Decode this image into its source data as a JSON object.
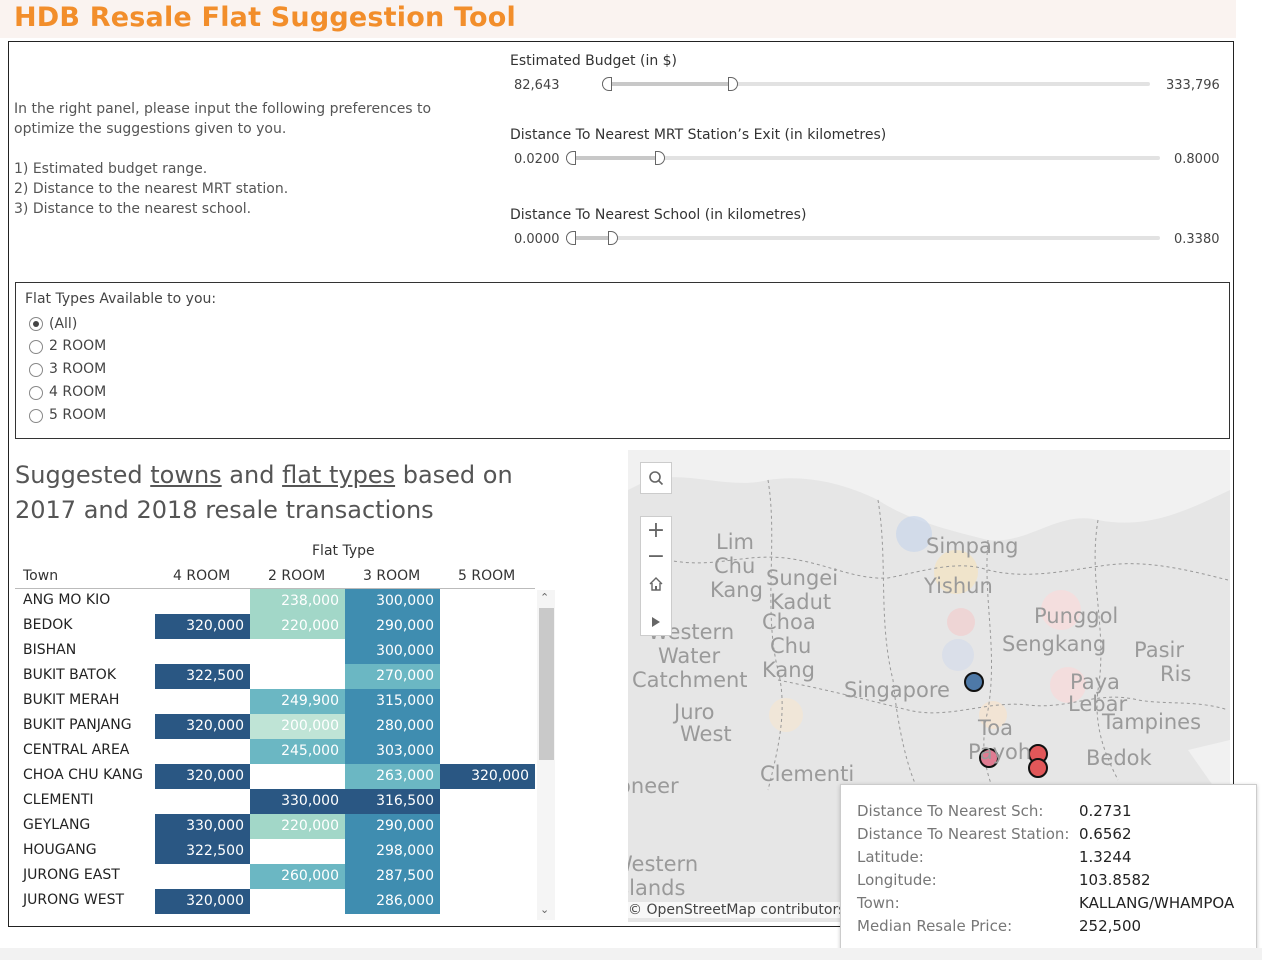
{
  "app": {
    "title": "HDB Resale Flat Suggestion Tool"
  },
  "instructions": {
    "intro": [
      "In the right panel, please input the following preferences to",
      "optimize the suggestions given to you."
    ],
    "items": [
      "1) Estimated budget range.",
      "2) Distance to the nearest MRT station.",
      "3) Distance to the nearest school."
    ]
  },
  "sliders": {
    "budget": {
      "label": "Estimated Budget (in $)",
      "min": "82,643",
      "max": "333,796",
      "fill_start": 0.0,
      "fill_end": 0.24
    },
    "mrt": {
      "label": "Distance To Nearest MRT Station’s Exit (in kilometres)",
      "min": "0.0200",
      "max": "0.8000",
      "fill_start": 0.0,
      "fill_end": 0.16
    },
    "school": {
      "label": "Distance To Nearest School (in kilometres)",
      "min": "0.0000",
      "max": "0.3380",
      "fill_start": 0.0,
      "fill_end": 0.08
    }
  },
  "flat_types": {
    "title": "Flat Types Available to you:",
    "options": [
      "(All)",
      "2 ROOM",
      "3 ROOM",
      "4 ROOM",
      "5 ROOM"
    ],
    "selected": "(All)"
  },
  "suggestions": {
    "heading_line1_a": "Suggested ",
    "heading_towns": "towns",
    "heading_and": " and ",
    "heading_flat_types": "flat types",
    "heading_line1_b": " based on",
    "heading_line2": "2017 and 2018 resale transactions"
  },
  "table": {
    "group_header": "Flat Type",
    "row_header": "Town",
    "columns": [
      "4 ROOM",
      "2 ROOM",
      "3 ROOM",
      "5 ROOM"
    ],
    "rows": [
      {
        "town": "ANG MO KIO",
        "values": [
          "",
          "238,000",
          "300,000",
          ""
        ]
      },
      {
        "town": "BEDOK",
        "values": [
          "320,000",
          "220,000",
          "290,000",
          ""
        ]
      },
      {
        "town": "BISHAN",
        "values": [
          "",
          "",
          "300,000",
          ""
        ]
      },
      {
        "town": "BUKIT BATOK",
        "values": [
          "322,500",
          "",
          "270,000",
          ""
        ]
      },
      {
        "town": "BUKIT MERAH",
        "values": [
          "",
          "249,900",
          "315,000",
          ""
        ]
      },
      {
        "town": "BUKIT PANJANG",
        "values": [
          "320,000",
          "200,000",
          "280,000",
          ""
        ]
      },
      {
        "town": "CENTRAL AREA",
        "values": [
          "",
          "245,000",
          "303,000",
          ""
        ]
      },
      {
        "town": "CHOA CHU KANG",
        "values": [
          "320,000",
          "",
          "263,000",
          "320,000"
        ]
      },
      {
        "town": "CLEMENTI",
        "values": [
          "",
          "330,000",
          "316,500",
          ""
        ]
      },
      {
        "town": "GEYLANG",
        "values": [
          "330,000",
          "220,000",
          "290,000",
          ""
        ]
      },
      {
        "town": "HOUGANG",
        "values": [
          "322,500",
          "",
          "298,000",
          ""
        ]
      },
      {
        "town": "JURONG EAST",
        "values": [
          "",
          "260,000",
          "287,500",
          ""
        ]
      },
      {
        "town": "JURONG WEST",
        "values": [
          "320,000",
          "",
          "286,000",
          ""
        ]
      }
    ],
    "colors": {
      "dark": "#2a5783",
      "mid": "#3f8db0",
      "light": "#6bb7c3",
      "pale": "#a2d7c8",
      "paler": "#bfe4d6"
    }
  },
  "map": {
    "labels": [
      "Lim",
      "Chu",
      "Kang",
      "Sungei",
      "Kadut",
      "Choa",
      "Chu",
      "Kang",
      "Western",
      "Water",
      "Catchment",
      "Juro",
      "West",
      "Simpang",
      "Yishun",
      "Punggol",
      "Sengkang",
      "Pasir",
      "Ris",
      "Paya",
      "Lebar",
      "Tampines",
      "Singapore",
      "Toa",
      "Payoh",
      "Bedok",
      "Clementi",
      "Pioneer",
      "Western",
      "Islands"
    ],
    "attribution": "© OpenStreetMap contributors",
    "controls": {
      "search": "search-icon",
      "zoom_in": "+",
      "zoom_out": "−",
      "home": "home-icon",
      "expand": "play-icon"
    }
  },
  "tooltip": {
    "rows": [
      {
        "key": "Distance To Nearest Sch:",
        "value": "0.2731"
      },
      {
        "key": "Distance To Nearest Station:",
        "value": "0.6562"
      },
      {
        "key": "Latitude:",
        "value": "1.3244"
      },
      {
        "key": "Longitude:",
        "value": "103.8582"
      },
      {
        "key": "Town:",
        "value": "KALLANG/WHAMPOA"
      },
      {
        "key": "Median Resale Price:",
        "value": "252,500"
      }
    ]
  }
}
